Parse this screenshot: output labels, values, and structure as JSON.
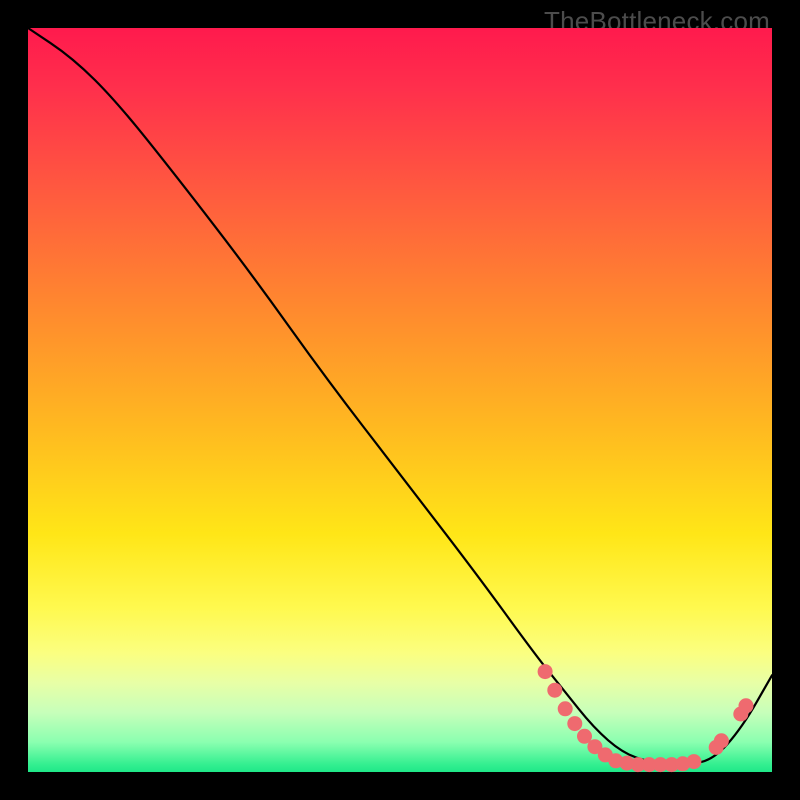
{
  "watermark": "TheBottleneck.com",
  "colors": {
    "page_bg": "#000000",
    "gradient_top": "#ff1a4d",
    "gradient_mid": "#ffe617",
    "gradient_bottom": "#1fe888",
    "curve": "#000000",
    "dot": "#ef6a6f"
  },
  "chart_data": {
    "type": "line",
    "title": "",
    "xlabel": "",
    "ylabel": "",
    "xlim": [
      0,
      100
    ],
    "ylim": [
      0,
      100
    ],
    "annotations": [
      "TheBottleneck.com"
    ],
    "series": [
      {
        "name": "curve",
        "x": [
          0,
          6,
          12,
          20,
          30,
          40,
          50,
          60,
          68,
          72,
          76,
          80,
          84,
          88,
          92,
          96,
          100
        ],
        "y": [
          100,
          96,
          90,
          80,
          67,
          53,
          40,
          27,
          16,
          11,
          6,
          2.5,
          1.2,
          1.0,
          1.5,
          6,
          13
        ]
      }
    ],
    "points": [
      {
        "name": "cluster-left",
        "x": 69.5,
        "y": 13.5
      },
      {
        "name": "cluster-left",
        "x": 70.8,
        "y": 11.0
      },
      {
        "name": "cluster-left",
        "x": 72.2,
        "y": 8.5
      },
      {
        "name": "cluster-left",
        "x": 73.5,
        "y": 6.5
      },
      {
        "name": "cluster-left",
        "x": 74.8,
        "y": 4.8
      },
      {
        "name": "cluster-left",
        "x": 76.2,
        "y": 3.4
      },
      {
        "name": "cluster-left",
        "x": 77.6,
        "y": 2.3
      },
      {
        "name": "valley",
        "x": 79.0,
        "y": 1.5
      },
      {
        "name": "valley",
        "x": 80.5,
        "y": 1.2
      },
      {
        "name": "valley",
        "x": 82.0,
        "y": 1.0
      },
      {
        "name": "valley",
        "x": 83.5,
        "y": 1.0
      },
      {
        "name": "valley",
        "x": 85.0,
        "y": 1.0
      },
      {
        "name": "valley",
        "x": 86.5,
        "y": 1.0
      },
      {
        "name": "valley",
        "x": 88.0,
        "y": 1.1
      },
      {
        "name": "valley",
        "x": 89.5,
        "y": 1.4
      },
      {
        "name": "cluster-right",
        "x": 92.5,
        "y": 3.3
      },
      {
        "name": "cluster-right",
        "x": 93.2,
        "y": 4.2
      },
      {
        "name": "cluster-right",
        "x": 95.8,
        "y": 7.8
      },
      {
        "name": "cluster-right",
        "x": 96.5,
        "y": 8.9
      }
    ]
  }
}
